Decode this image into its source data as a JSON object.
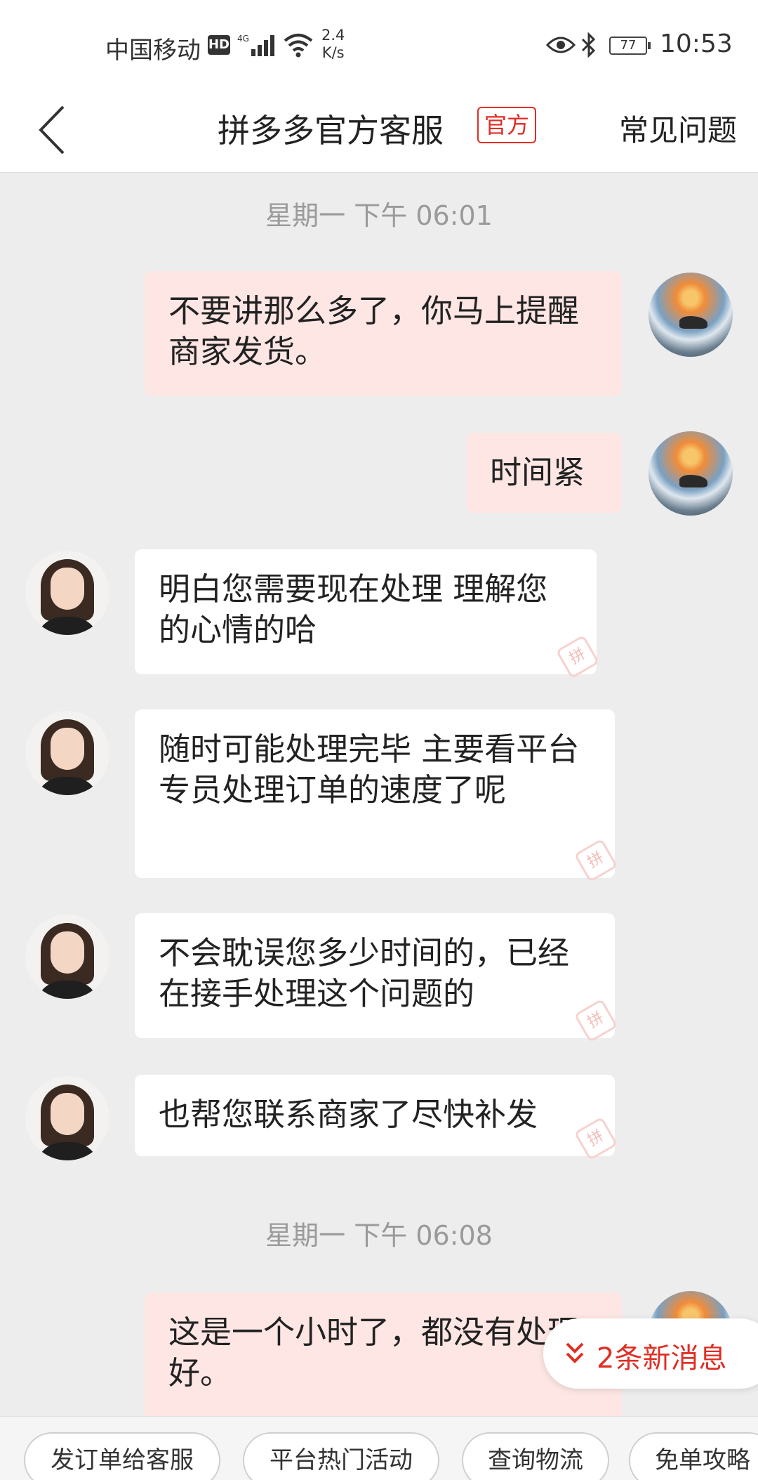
{
  "status_bar": {
    "carrier": "中国移动",
    "hd": "HD",
    "net_speed_value": "2.4",
    "net_speed_unit": "K/s",
    "battery": "77",
    "time": "10:53"
  },
  "header": {
    "title": "拼多多官方客服",
    "badge": "官方",
    "faq": "常见问题"
  },
  "chat": {
    "timestamps": [
      "星期一 下午 06:01",
      "星期一 下午 06:08"
    ],
    "messages": [
      {
        "from": "user",
        "text": "不要讲那么多了，你马上提醒商家发货。"
      },
      {
        "from": "user",
        "text": "时间紧"
      },
      {
        "from": "agent",
        "text": "明白您需要现在处理  理解您的心情的哈"
      },
      {
        "from": "agent",
        "text": "随时可能处理完毕 主要看平台专员处理订单的速度了呢"
      },
      {
        "from": "agent",
        "text": "不会耽误您多少时间的，已经在接手处理这个问题的"
      },
      {
        "from": "agent",
        "text": "也帮您联系商家了尽快补发"
      },
      {
        "from": "user",
        "text": "这是一个小时了，都没有处理好。"
      }
    ],
    "new_messages": "2条新消息"
  },
  "quick_replies": [
    "发订单给客服",
    "平台热门活动",
    "查询物流",
    "免单攻略"
  ],
  "icons": {
    "back": "back-arrow-icon",
    "new_msg": "double-chevron-down-icon"
  },
  "colors": {
    "accent": "#e02e24",
    "user_bubble": "#fde6e3",
    "agent_bubble": "#ffffff",
    "background": "#ededed"
  }
}
